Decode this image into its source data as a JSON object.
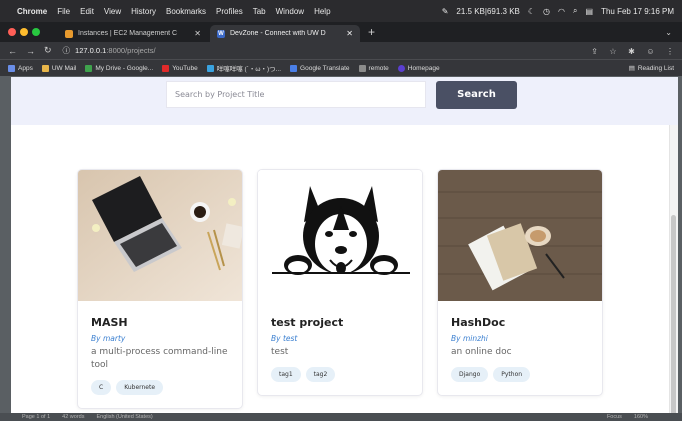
{
  "menubar": {
    "items": [
      "Chrome",
      "File",
      "Edit",
      "View",
      "History",
      "Bookmarks",
      "Profiles",
      "Tab",
      "Window",
      "Help"
    ],
    "network": "21.5 KB|691.3 KB",
    "datetime": "Thu Feb 17  9:16 PM"
  },
  "tabs": [
    {
      "title": "Instances | EC2 Management C",
      "favicon_color": "#e89a2e"
    },
    {
      "title": "DevZone - Connect with UW D",
      "favicon_color": "#3a68c7",
      "favicon_letter": "W"
    }
  ],
  "address": {
    "host": "127.0.0.1",
    "path": ":8000/projects/"
  },
  "bookmarks": [
    {
      "label": "Apps",
      "icon_color": "#6a8ee8"
    },
    {
      "label": "UW Mail",
      "icon_color": "#e8b64a"
    },
    {
      "label": "My Drive - Google...",
      "icon_color": "#3fa34d"
    },
    {
      "label": "YouTube",
      "icon_color": "#e02a2a"
    },
    {
      "label": "咩噻咩噻 (´・ω・)つ...",
      "icon_color": "#3aa3e0"
    },
    {
      "label": "Google Translate",
      "icon_color": "#4a7fe8"
    },
    {
      "label": "remote",
      "icon_color": "#8c8c8c"
    },
    {
      "label": "Homepage",
      "icon_color": "#5b3fd0"
    }
  ],
  "reading_list": "Reading List",
  "search": {
    "placeholder": "Search by Project Title",
    "button_label": "Search"
  },
  "projects": [
    {
      "title": "MASH",
      "author": "By marty",
      "description": "a multi-process command-line tool",
      "tags": [
        "C",
        "Kubernete"
      ]
    },
    {
      "title": "test project",
      "author": "By test",
      "description": "test",
      "tags": [
        "tag1",
        "tag2"
      ]
    },
    {
      "title": "HashDoc",
      "author": "By minzhi",
      "description": "an online doc",
      "tags": [
        "Django",
        "Python"
      ]
    }
  ],
  "statusbar": {
    "page": "Page 1 of 1",
    "words": "42 words",
    "language": "English (United States)",
    "focus": "Focus",
    "zoom": "160%"
  },
  "colors": {
    "accent": "#4a5064",
    "band": "#eef0fb",
    "author": "#3a7fd0",
    "tag_bg": "#e6f0f8"
  }
}
